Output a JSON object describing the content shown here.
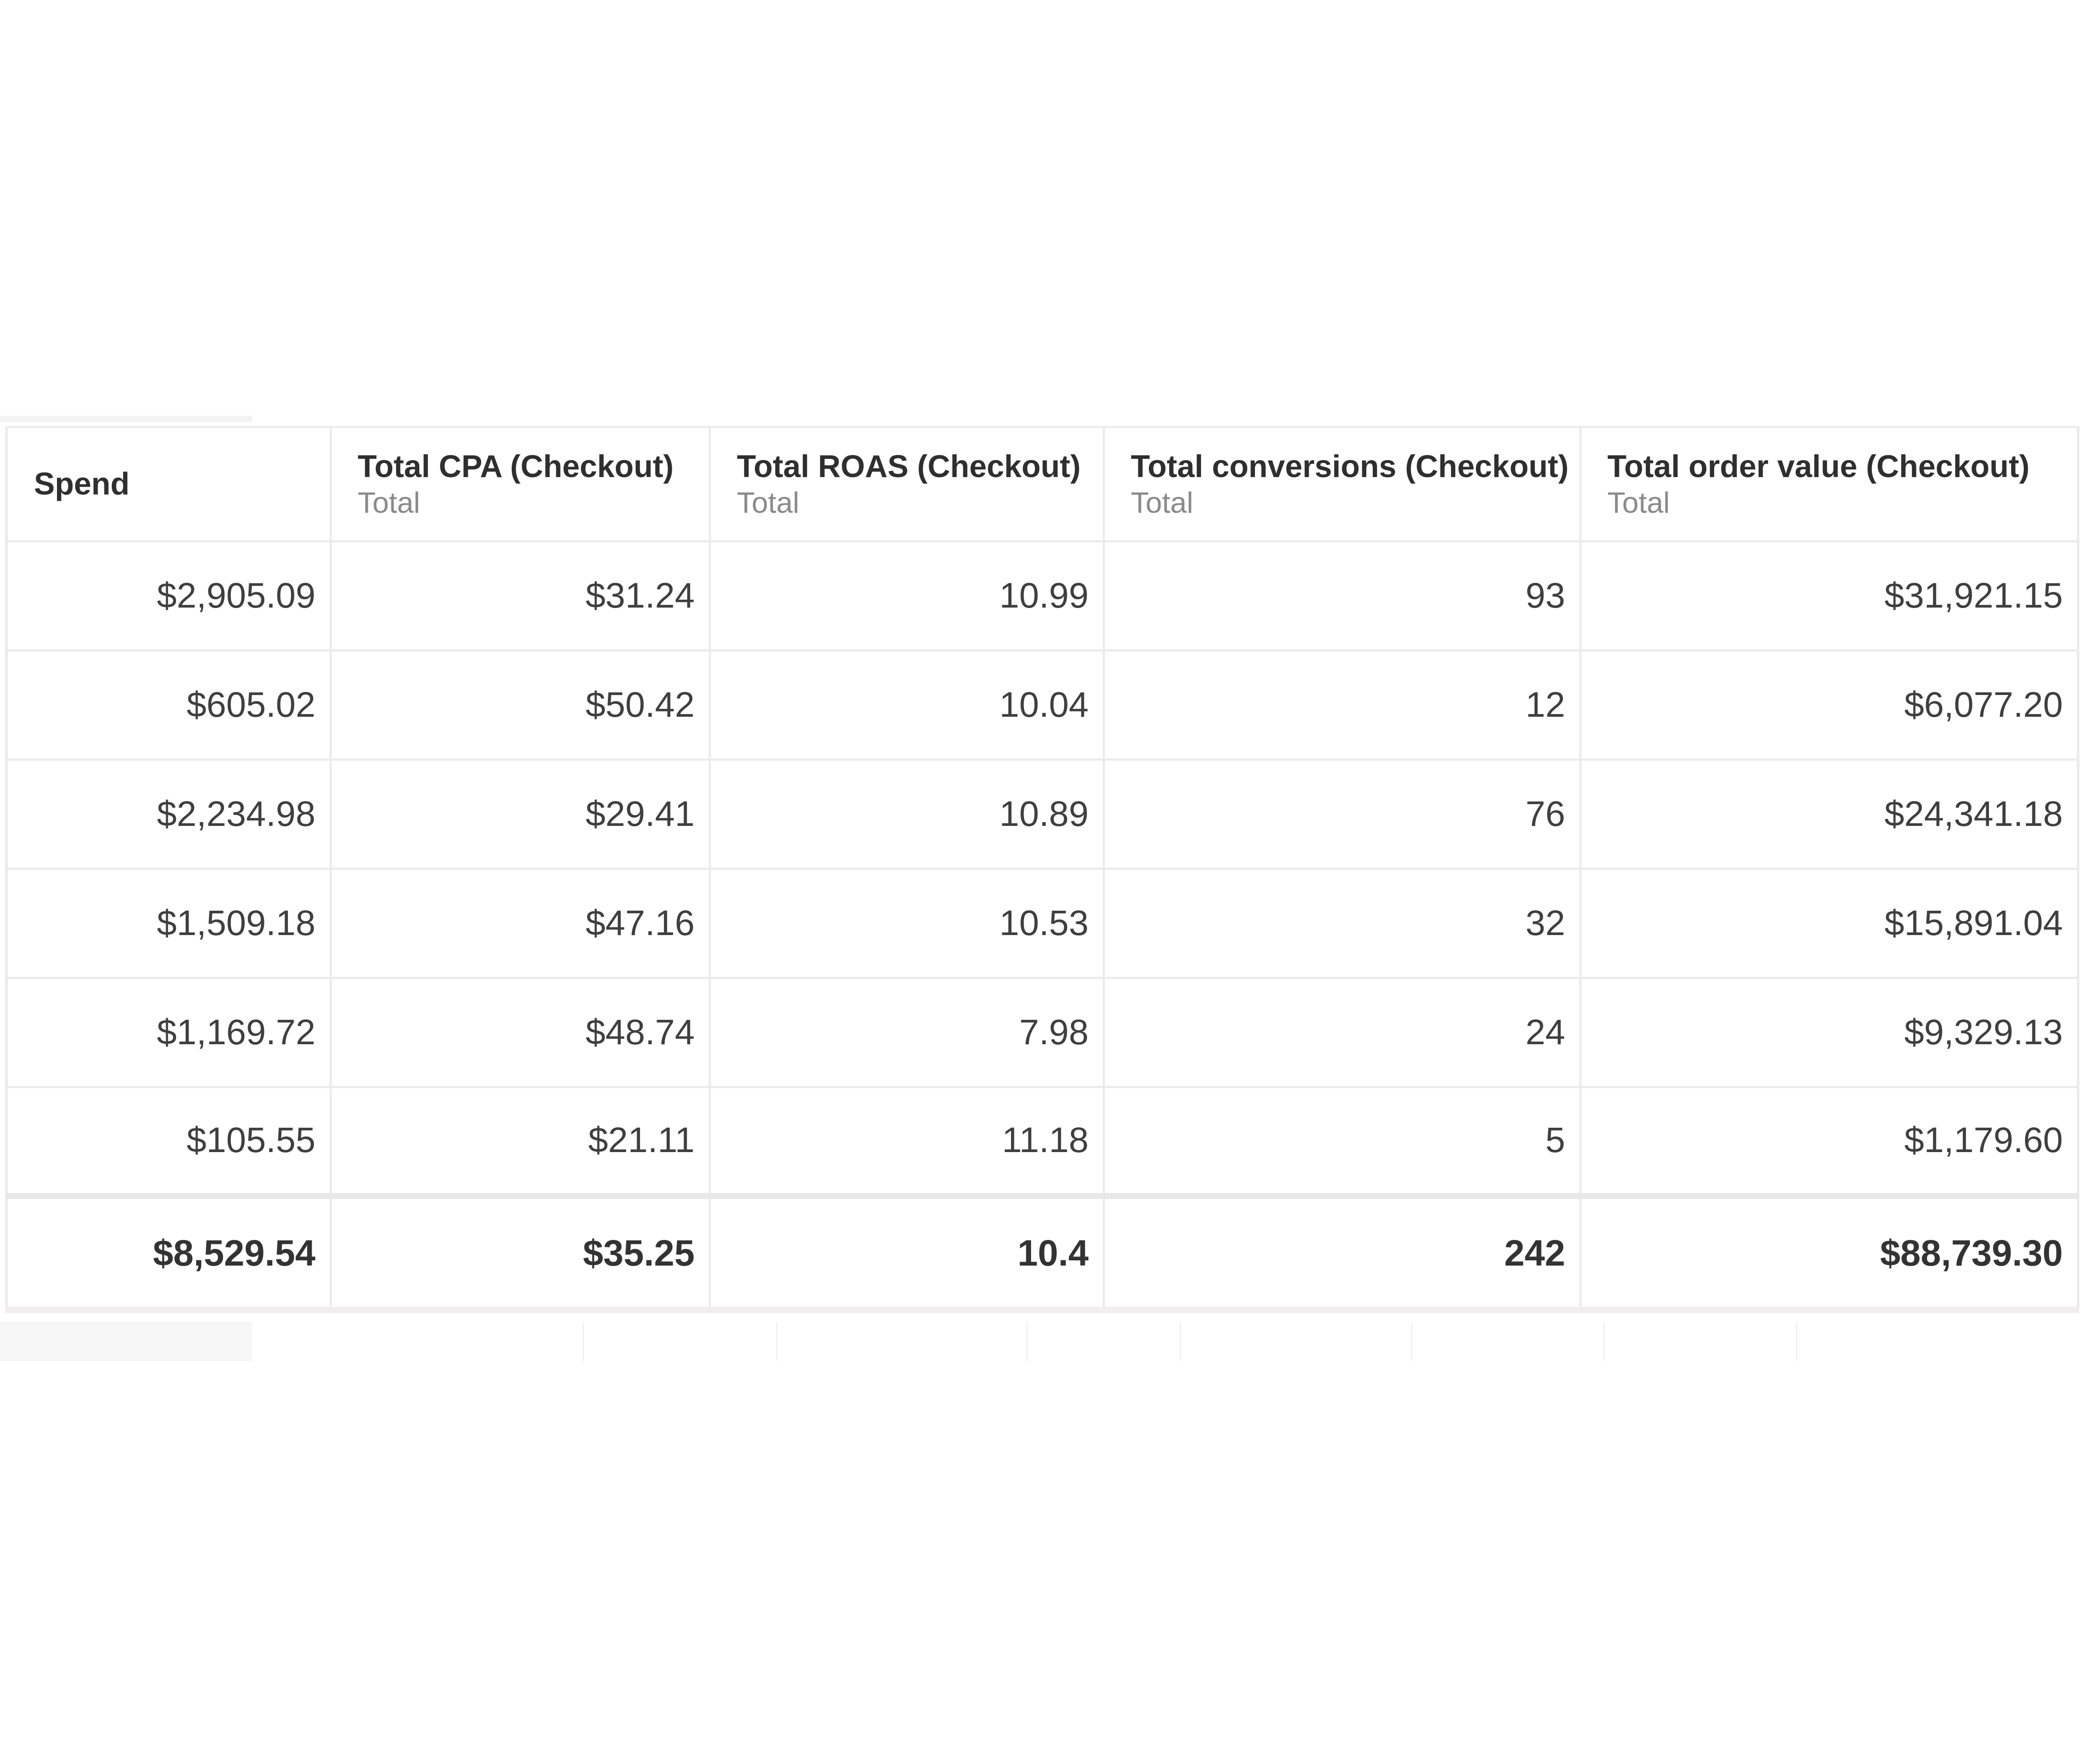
{
  "columns": [
    {
      "title": "Spend",
      "sub": ""
    },
    {
      "title": "Total CPA (Checkout)",
      "sub": "Total"
    },
    {
      "title": "Total ROAS (Checkout)",
      "sub": "Total"
    },
    {
      "title": "Total conversions (Checkout)",
      "sub": "Total"
    },
    {
      "title": "Total order value (Checkout)",
      "sub": "Total"
    }
  ],
  "rows": [
    [
      "$2,905.09",
      "$31.24",
      "10.99",
      "93",
      "$31,921.15"
    ],
    [
      "$605.02",
      "$50.42",
      "10.04",
      "12",
      "$6,077.20"
    ],
    [
      "$2,234.98",
      "$29.41",
      "10.89",
      "76",
      "$24,341.18"
    ],
    [
      "$1,509.18",
      "$47.16",
      "10.53",
      "32",
      "$15,891.04"
    ],
    [
      "$1,169.72",
      "$48.74",
      "7.98",
      "24",
      "$9,329.13"
    ],
    [
      "$105.55",
      "$21.11",
      "11.18",
      "5",
      "$1,179.60"
    ]
  ],
  "totals": [
    "$8,529.54",
    "$35.25",
    "10.4",
    "242",
    "$88,739.30"
  ]
}
